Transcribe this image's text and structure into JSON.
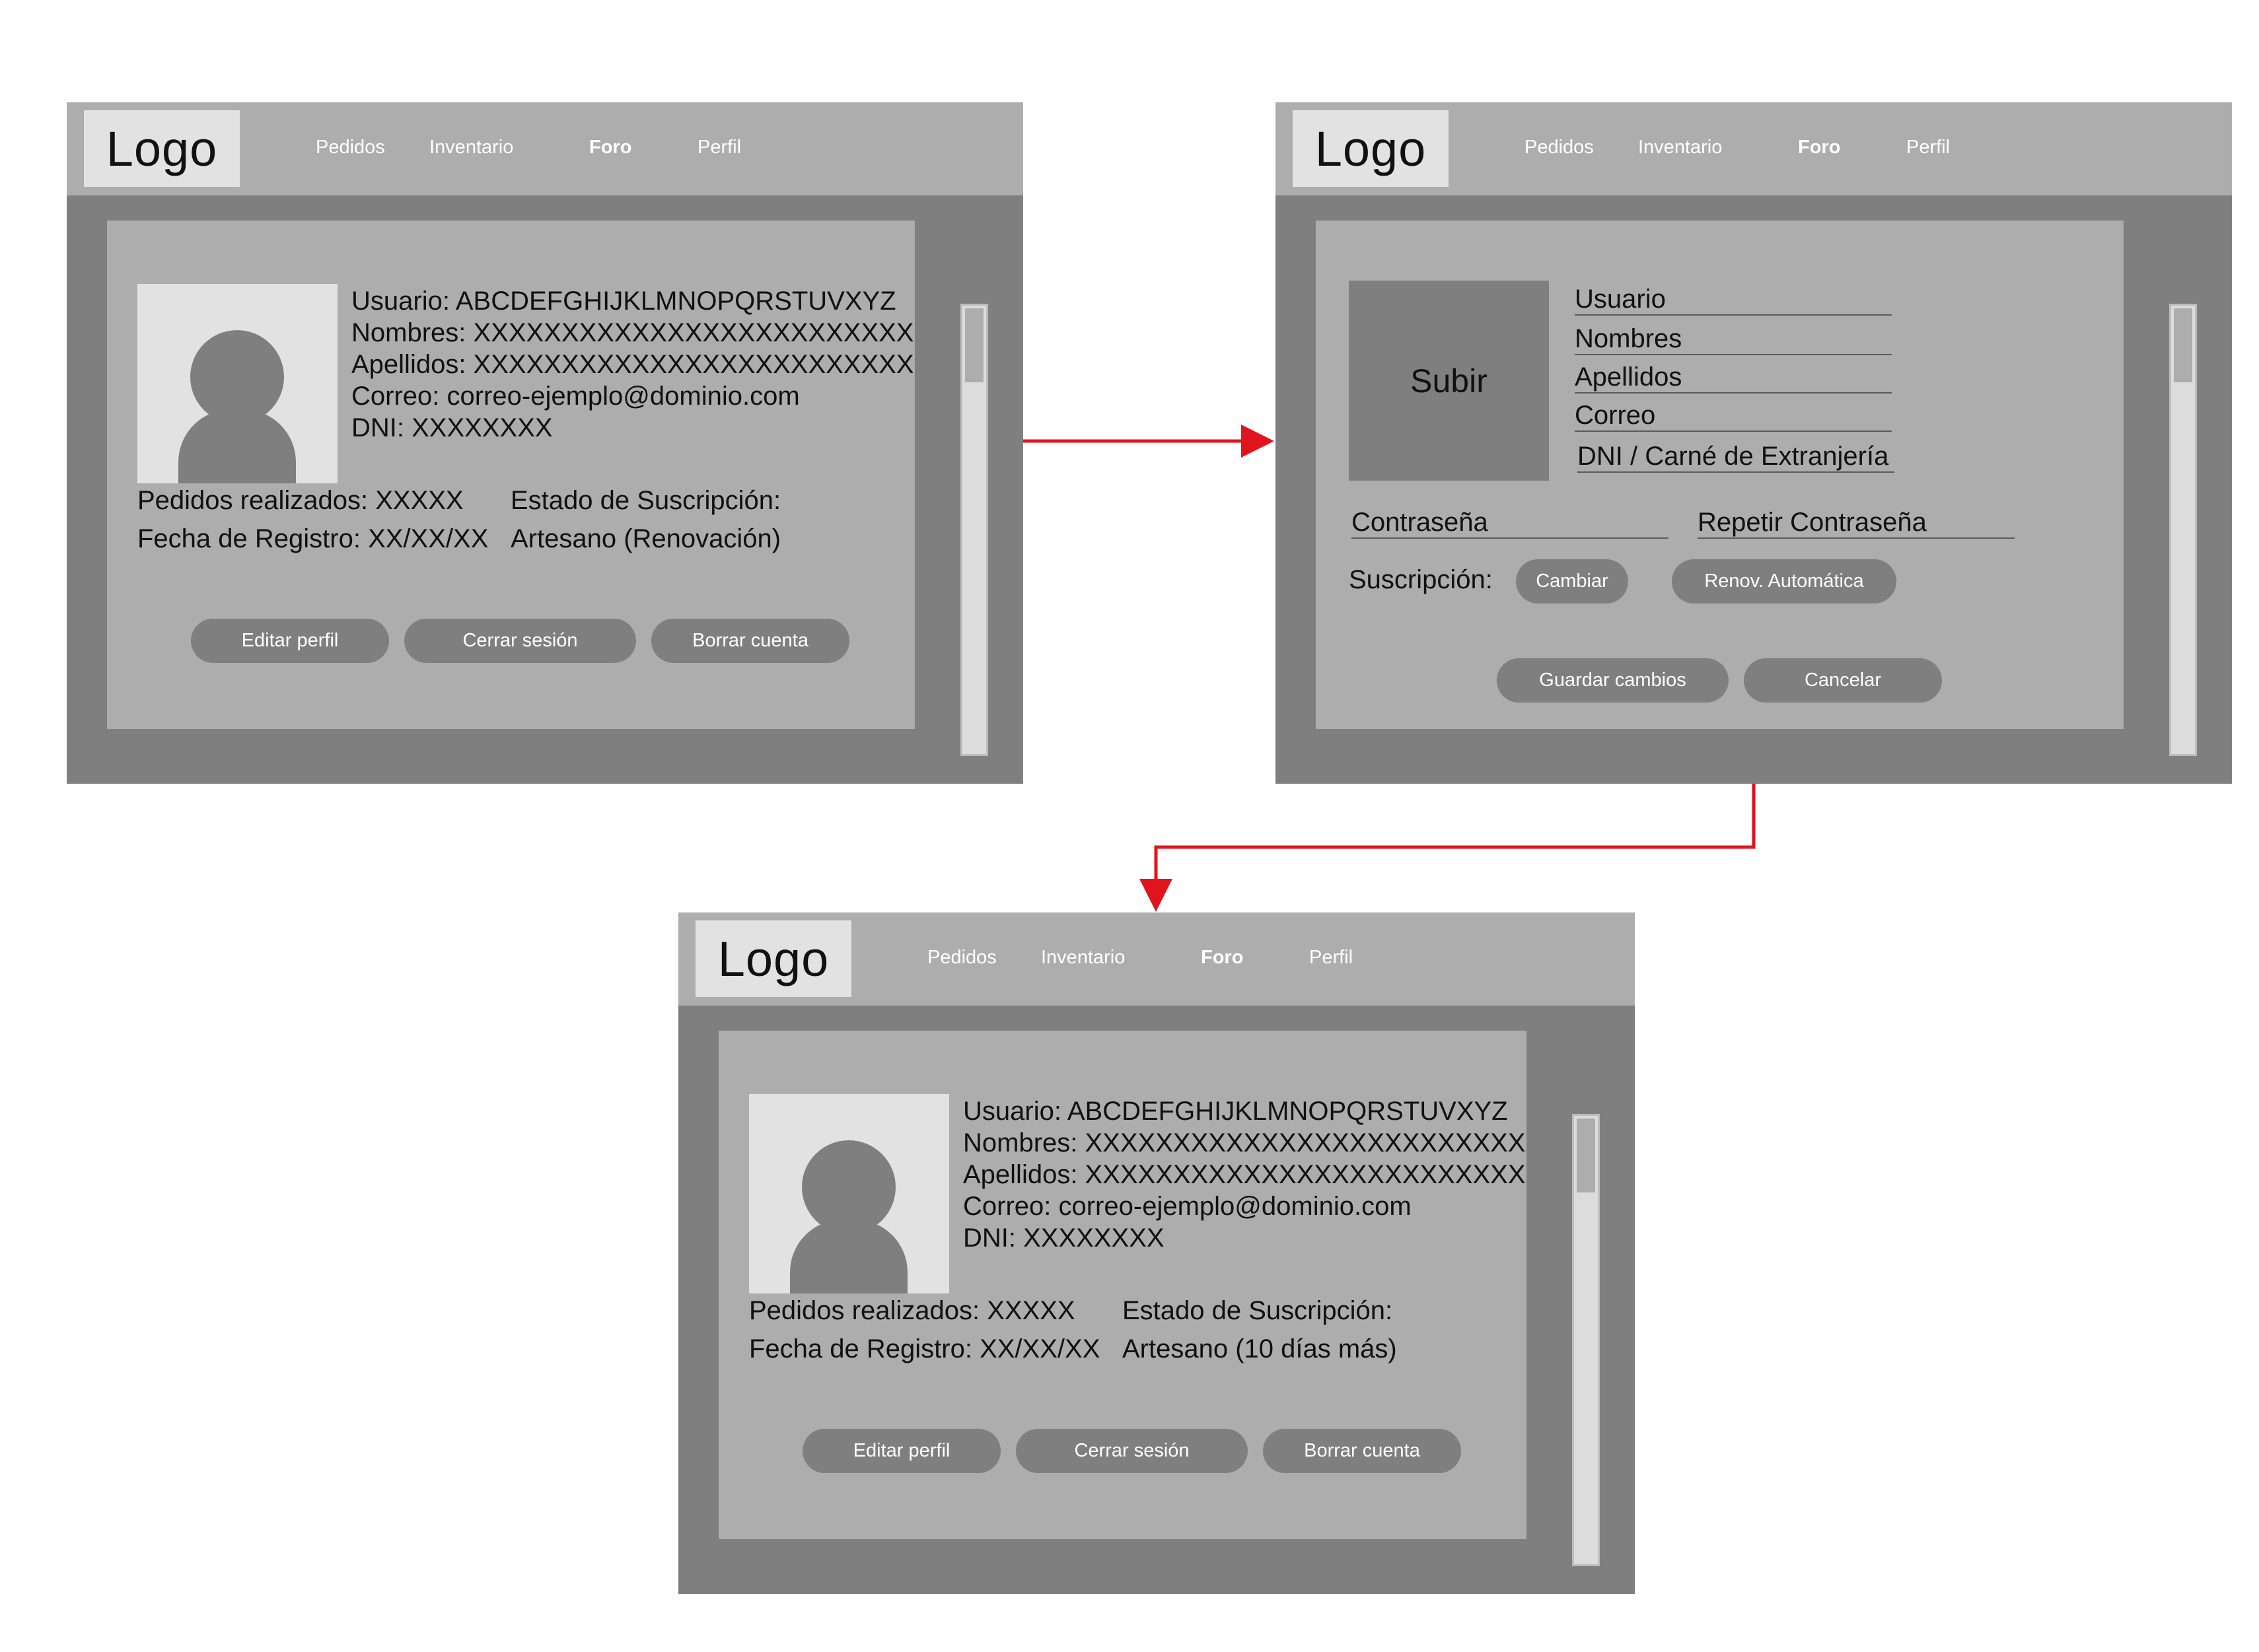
{
  "nav": {
    "logo": "Logo",
    "items": [
      "Pedidos",
      "Inventario",
      "Foro",
      "Perfil"
    ]
  },
  "profile_view_1": {
    "usuario": "Usuario: ABCDEFGHIJKLMNOPQRSTUVXYZ",
    "nombres": "Nombres: XXXXXXXXXXXXXXXXXXXXXXXXX",
    "apellidos": "Apellidos: XXXXXXXXXXXXXXXXXXXXXXXXX",
    "correo": "Correo: correo-ejemplo@dominio.com",
    "dni": "DNI: XXXXXXXX",
    "pedidos": "Pedidos realizados: XXXXX",
    "fecha": "Fecha de Registro: XX/XX/XX",
    "estado_label": "Estado de Suscripción:",
    "estado_value": "Artesano (Renovación)",
    "buttons": [
      "Editar perfil",
      "Cerrar sesión",
      "Borrar cuenta"
    ]
  },
  "profile_edit": {
    "upload": "Subir",
    "fields": [
      "Usuario",
      "Nombres",
      "Apellidos",
      "Correo",
      "DNI / Carné de Extranjería"
    ],
    "password": "Contraseña",
    "repeat_password": "Repetir Contraseña",
    "subscription_label": "Suscripción:",
    "change": "Cambiar",
    "auto_renew": "Renov. Automática",
    "save": "Guardar cambios",
    "cancel": "Cancelar"
  },
  "profile_view_2": {
    "usuario": "Usuario: ABCDEFGHIJKLMNOPQRSTUVXYZ",
    "nombres": "Nombres: XXXXXXXXXXXXXXXXXXXXXXXXX",
    "apellidos": "Apellidos: XXXXXXXXXXXXXXXXXXXXXXXXX",
    "correo": "Correo: correo-ejemplo@dominio.com",
    "dni": "DNI: XXXXXXXX",
    "pedidos": "Pedidos realizados: XXXXX",
    "fecha": "Fecha de Registro: XX/XX/XX",
    "estado_label": "Estado de Suscripción:",
    "estado_value": "Artesano (10 días más)",
    "buttons": [
      "Editar perfil",
      "Cerrar sesión",
      "Borrar cuenta"
    ]
  },
  "colors": {
    "frame": "#7f7f7f",
    "header": "#adadad",
    "logo_box": "#e2e2e2",
    "arrow": "#e0141c"
  }
}
